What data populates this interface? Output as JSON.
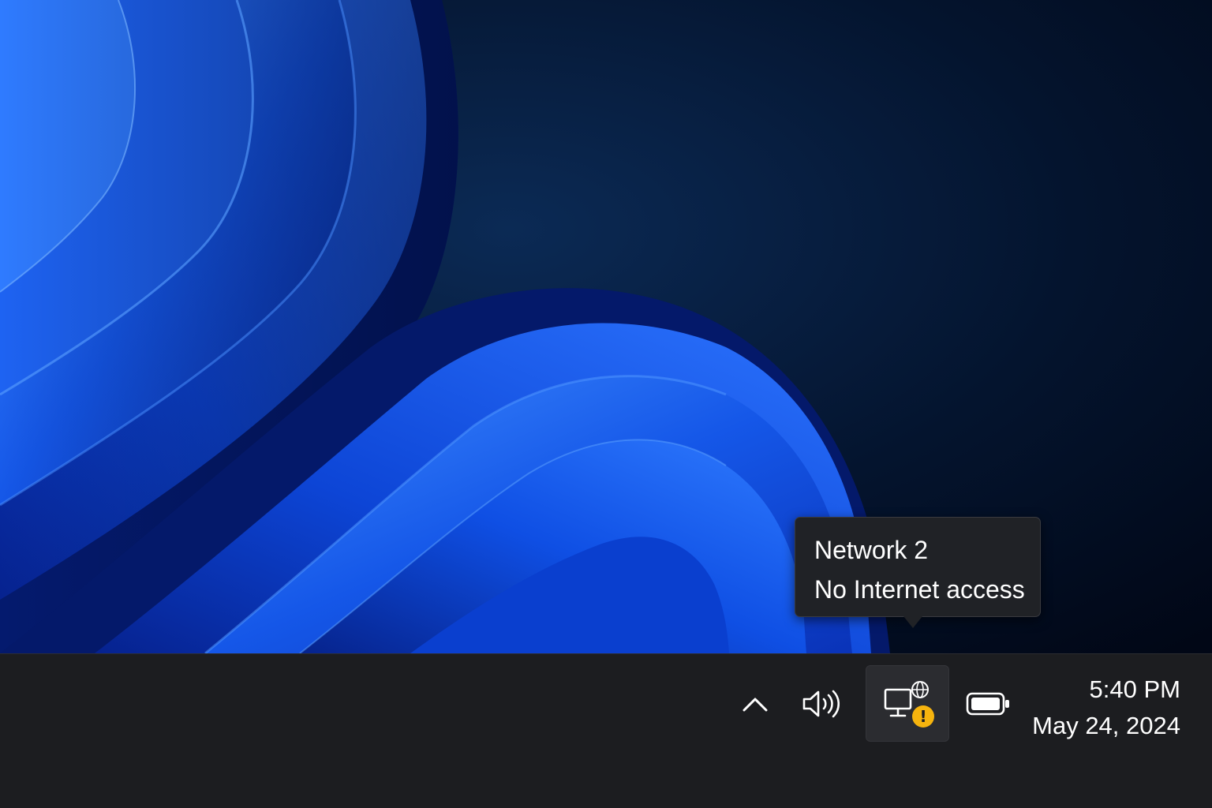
{
  "tooltip": {
    "network_name": "Network  2",
    "status": "No Internet access"
  },
  "tray": {
    "icons": {
      "overflow": "chevron-up-icon",
      "volume": "speaker-volume-icon",
      "network": "network-no-internet-icon",
      "network_badge": "warning-badge-icon",
      "battery": "battery-icon"
    },
    "network_badge_glyph": "!",
    "badge_color": "#f6b40e"
  },
  "clock": {
    "time": "5:40 PM",
    "date": "May 24, 2024"
  },
  "colors": {
    "taskbar": "#1c1d20",
    "tooltip_bg": "#202226",
    "wallpaper_accent": "#0a5cf0"
  }
}
